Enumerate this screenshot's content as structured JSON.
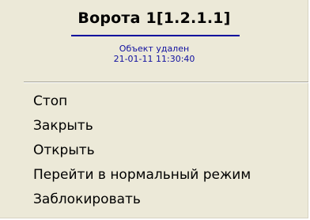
{
  "menu": {
    "title": "Ворота 1[1.2.1.1]",
    "status": "Объект удален",
    "timestamp": "21-01-11 11:30:40",
    "items": [
      {
        "label": "Стоп"
      },
      {
        "label": "Закрыть"
      },
      {
        "label": "Открыть"
      },
      {
        "label": "Перейти в нормальный режим"
      },
      {
        "label": "Заблокировать"
      }
    ]
  },
  "colors": {
    "background": "#ece9d8",
    "accent_line": "#00009c",
    "status_text": "#1010a0",
    "text": "#000000"
  }
}
